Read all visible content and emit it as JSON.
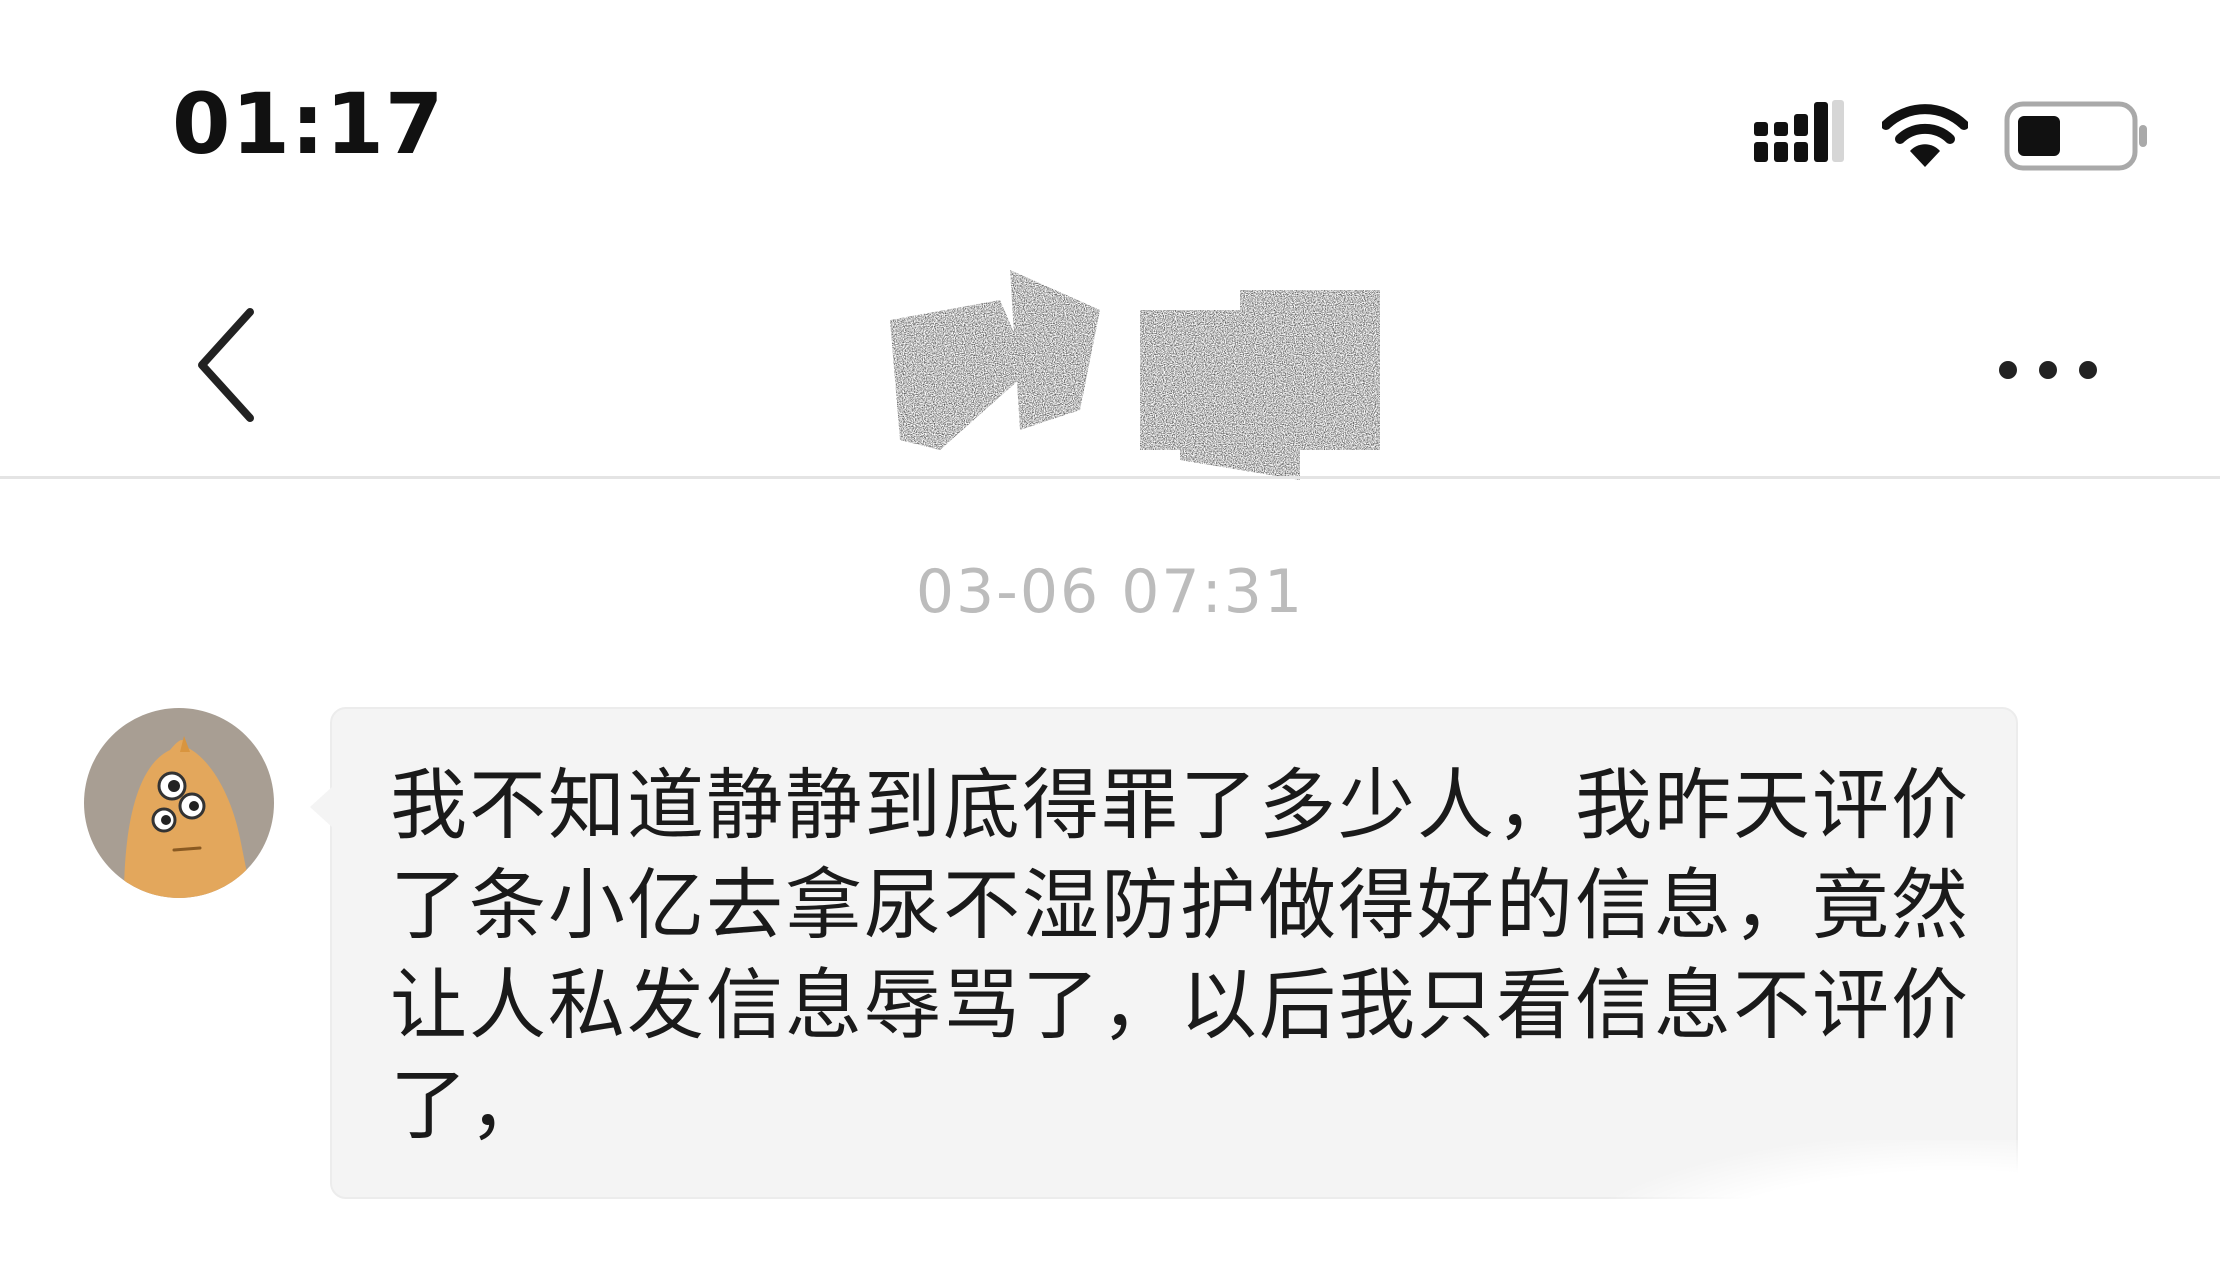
{
  "status_bar": {
    "time": "01:17",
    "icons": [
      "cellular-signal-icon",
      "wifi-icon",
      "battery-icon"
    ]
  },
  "nav_bar": {
    "back_icon": "chevron-left-icon",
    "title_redacted": true,
    "more_icon": "more-horizontal-icon"
  },
  "chat": {
    "timestamp": "03-06 07:31",
    "messages": [
      {
        "direction": "incoming",
        "avatar_icon": "cartoon-avatar-icon",
        "text": "我不知道静静到底得罪了多少人，我昨天评价了条小亿去拿尿不湿防护做得好的信息，竟然让人私发信息辱骂了，以后我只看信息不评价了，"
      }
    ]
  },
  "colors": {
    "background": "#ffffff",
    "bubble": "#f4f4f4",
    "timestamp": "#bcbcbc",
    "text": "#1a1a1a",
    "avatar_bg": "#a89e93",
    "avatar_figure": "#e3a75c"
  }
}
